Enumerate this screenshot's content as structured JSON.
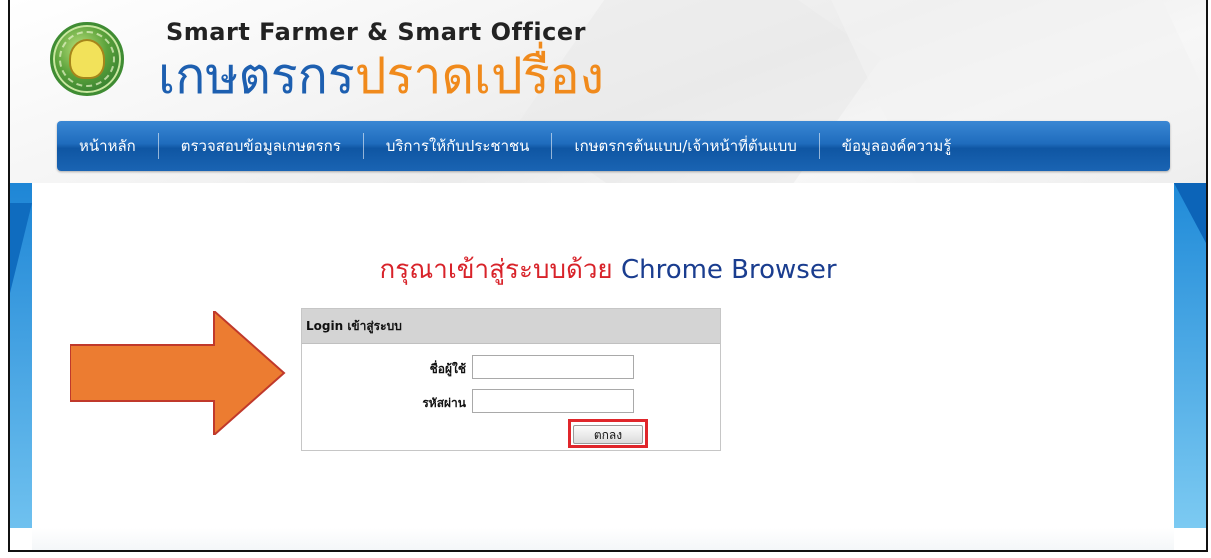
{
  "header": {
    "brand_small": "Smart Farmer & Smart Officer",
    "brand_big_part1": "เกษตรกร",
    "brand_big_part2": "ปราดเปรื่อง",
    "logo_icon": "ministry-of-agriculture-seal"
  },
  "nav": {
    "items": [
      {
        "label": "หน้าหลัก"
      },
      {
        "label": "ตรวจสอบข้อมูลเกษตรกร"
      },
      {
        "label": "บริการให้กับประชาชน"
      },
      {
        "label": "เกษตรกรต้นแบบ/เจ้าหน้าที่ต้นแบบ"
      },
      {
        "label": "ข้อมูลองค์ความรู้"
      }
    ]
  },
  "notice": {
    "thai_text": "กรุณาเข้าสู่ระบบด้วย",
    "browser_text": "Chrome Browser"
  },
  "login": {
    "title": "Login เข้าสู่ระบบ",
    "username_label": "ชื่อผู้ใช้",
    "username_value": "",
    "password_label": "รหัสผ่าน",
    "password_value": "",
    "submit_label": "ตกลง"
  },
  "colors": {
    "nav_blue": "#1f6cbd",
    "brand_blue": "#1d5fb0",
    "brand_orange": "#f08a1c",
    "notice_red": "#d8232a",
    "notice_blue": "#1a3d8f",
    "arrow_orange": "#ec7c31",
    "highlight_red": "#e0262b"
  },
  "icons": {
    "annotation_arrow": "right-arrow-icon"
  }
}
